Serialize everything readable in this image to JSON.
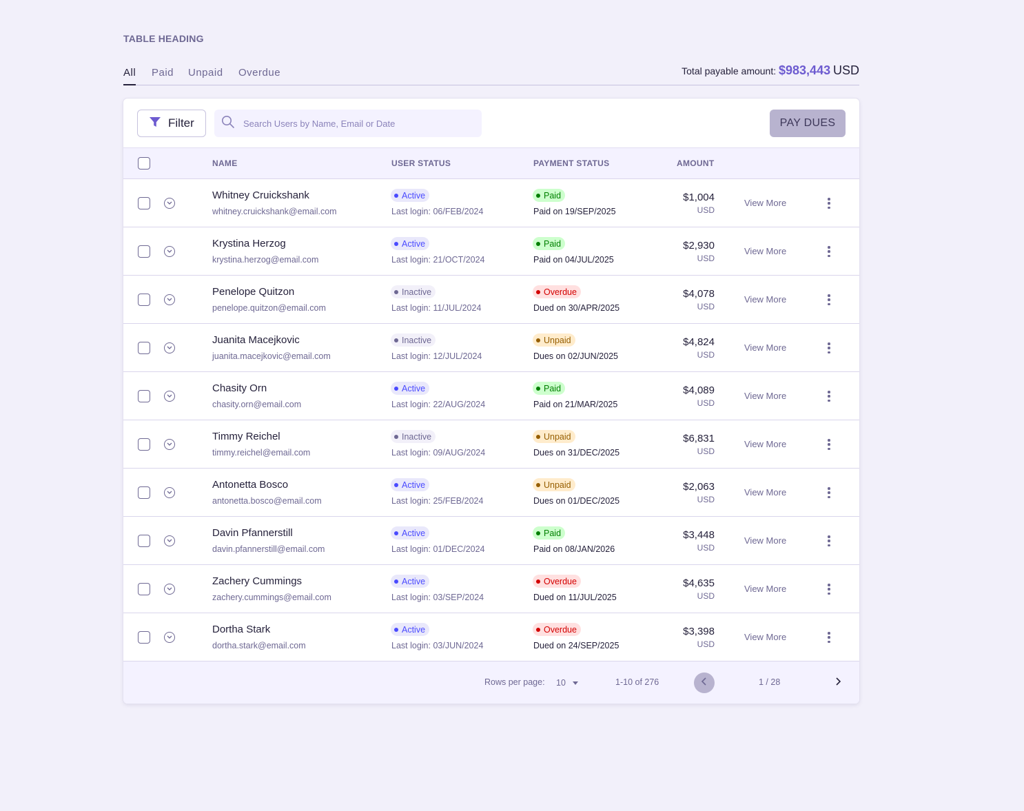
{
  "heading": "TABLE HEADING",
  "tabs": [
    {
      "label": "All",
      "active": true
    },
    {
      "label": "Paid",
      "active": false
    },
    {
      "label": "Unpaid",
      "active": false
    },
    {
      "label": "Overdue",
      "active": false
    }
  ],
  "total": {
    "label": "Total payable amount:",
    "amount": "$983,443",
    "currency": "USD"
  },
  "toolbar": {
    "filter_label": "Filter",
    "search_placeholder": "Search Users by Name, Email or Date",
    "pay_label": "PAY DUES"
  },
  "columns": {
    "name": "NAME",
    "user_status": "USER STATUS",
    "payment_status": "PAYMENT STATUS",
    "amount": "AMOUNT"
  },
  "rows": [
    {
      "name": "Whitney Cruickshank",
      "email": "whitney.cruickshank@email.com",
      "user_status": "Active",
      "last_login": "Last login: 06/FEB/2024",
      "payment_status": "Paid",
      "payment_note": "Paid on 19/SEP/2025",
      "amount": "$1,004",
      "currency": "USD",
      "view_more": "View More"
    },
    {
      "name": "Krystina Herzog",
      "email": "krystina.herzog@email.com",
      "user_status": "Active",
      "last_login": "Last login: 21/OCT/2024",
      "payment_status": "Paid",
      "payment_note": "Paid on 04/JUL/2025",
      "amount": "$2,930",
      "currency": "USD",
      "view_more": "View More"
    },
    {
      "name": "Penelope Quitzon",
      "email": "penelope.quitzon@email.com",
      "user_status": "Inactive",
      "last_login": "Last login: 11/JUL/2024",
      "payment_status": "Overdue",
      "payment_note": "Dued on 30/APR/2025",
      "amount": "$4,078",
      "currency": "USD",
      "view_more": "View More"
    },
    {
      "name": "Juanita Macejkovic",
      "email": "juanita.macejkovic@email.com",
      "user_status": "Inactive",
      "last_login": "Last login: 12/JUL/2024",
      "payment_status": "Unpaid",
      "payment_note": "Dues on 02/JUN/2025",
      "amount": "$4,824",
      "currency": "USD",
      "view_more": "View More"
    },
    {
      "name": "Chasity Orn",
      "email": "chasity.orn@email.com",
      "user_status": "Active",
      "last_login": "Last login: 22/AUG/2024",
      "payment_status": "Paid",
      "payment_note": "Paid on 21/MAR/2025",
      "amount": "$4,089",
      "currency": "USD",
      "view_more": "View More"
    },
    {
      "name": "Timmy Reichel",
      "email": "timmy.reichel@email.com",
      "user_status": "Inactive",
      "last_login": "Last login: 09/AUG/2024",
      "payment_status": "Unpaid",
      "payment_note": "Dues on 31/DEC/2025",
      "amount": "$6,831",
      "currency": "USD",
      "view_more": "View More"
    },
    {
      "name": "Antonetta Bosco",
      "email": "antonetta.bosco@email.com",
      "user_status": "Active",
      "last_login": "Last login: 25/FEB/2024",
      "payment_status": "Unpaid",
      "payment_note": "Dues on 01/DEC/2025",
      "amount": "$2,063",
      "currency": "USD",
      "view_more": "View More"
    },
    {
      "name": "Davin Pfannerstill",
      "email": "davin.pfannerstill@email.com",
      "user_status": "Active",
      "last_login": "Last login: 01/DEC/2024",
      "payment_status": "Paid",
      "payment_note": "Paid on 08/JAN/2026",
      "amount": "$3,448",
      "currency": "USD",
      "view_more": "View More"
    },
    {
      "name": "Zachery Cummings",
      "email": "zachery.cummings@email.com",
      "user_status": "Active",
      "last_login": "Last login: 03/SEP/2024",
      "payment_status": "Overdue",
      "payment_note": "Dued on 11/JUL/2025",
      "amount": "$4,635",
      "currency": "USD",
      "view_more": "View More"
    },
    {
      "name": "Dortha Stark",
      "email": "dortha.stark@email.com",
      "user_status": "Active",
      "last_login": "Last login: 03/JUN/2024",
      "payment_status": "Overdue",
      "payment_note": "Dued on 24/SEP/2025",
      "amount": "$3,398",
      "currency": "USD",
      "view_more": "View More"
    }
  ],
  "pagination": {
    "rows_per_page_label": "Rows per page:",
    "rows_per_page": "10",
    "range": "1-10 of 276",
    "pages": "1 / 28"
  },
  "colors": {
    "accent": "#6d5bd0",
    "muted": "#6e6893",
    "background": "#f2f0fa"
  }
}
